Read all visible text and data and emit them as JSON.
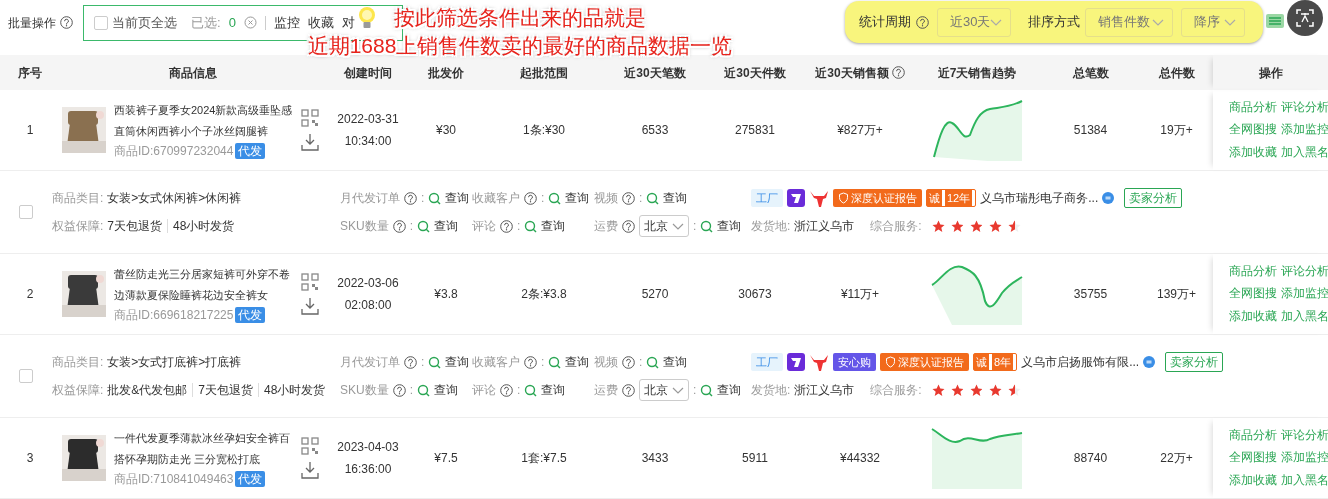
{
  "toolbar": {
    "batch_label": "批量操作",
    "select_all": {
      "label": "当前页全选",
      "checked": false
    },
    "selected_label": "已选:",
    "selected_count": "0",
    "actions": [
      "监控",
      "收藏",
      "对"
    ]
  },
  "filters": {
    "period_label": "统计周期",
    "period_value": "近30天",
    "sort_label": "排序方式",
    "sort_field": "销售件数",
    "sort_order": "降序"
  },
  "annotation": {
    "lines": [
      "按此筛选条件出来的品就是",
      "近期1688上销售件数卖的最好的商品数据一览"
    ]
  },
  "table": {
    "columns": [
      {
        "label": "序号"
      },
      {
        "label": "商品信息"
      },
      {
        "label": "创建时间"
      },
      {
        "label": "批发价"
      },
      {
        "label": "起批范围"
      },
      {
        "label": "近30天笔数"
      },
      {
        "label": "近30天件数"
      },
      {
        "label": "近30天销售额",
        "help": true
      },
      {
        "label": "近7天销售趋势"
      },
      {
        "label": "总笔数"
      },
      {
        "label": "总件数"
      },
      {
        "label": "操作"
      }
    ],
    "rows": [
      {
        "index": "1",
        "title": "西装裤子夏季女2024新款高级垂坠感直筒休闲西裤小个子冰丝阔腿裤",
        "id_label": "商品ID:",
        "id": "670997232044",
        "tag": "代发",
        "created_date": "2022-03-31",
        "created_time": "10:34:00",
        "price": "¥30",
        "moq": "1条:¥30",
        "orders_30d": "6533",
        "units_30d": "275831",
        "sales_30d": "¥827万+",
        "total_orders": "51384",
        "total_units": "19万+",
        "actions": [
          "商品分析",
          "评论分析",
          "全网图搜",
          "添加监控",
          "添加收藏",
          "加入黑名"
        ],
        "detail": {
          "checked": false,
          "category_label": "商品类目:",
          "category": "女装>女式休闲裤>休闲裤",
          "guarantee_label": "权益保障:",
          "guarantees": [
            "7天包退货",
            "48小时发货"
          ],
          "queries": [
            {
              "label": "月代发订单",
              "sep": ":",
              "action": "查询"
            },
            {
              "label": "收藏客户",
              "sep": ":",
              "action": "查询"
            },
            {
              "label": "视频",
              "sep": ":",
              "action": "查询"
            },
            {
              "label": "SKU数量",
              "sep": ":",
              "action": "查询"
            },
            {
              "label": "评论",
              "sep": ":",
              "action": "查询"
            },
            {
              "label": "运费",
              "select": "北京",
              "sep": ":",
              "action": "查询"
            }
          ],
          "badges": [
            {
              "kind": "factory",
              "text": "工厂"
            },
            {
              "kind": "purple-logo"
            },
            {
              "kind": "bull-logo"
            },
            {
              "kind": "cert",
              "text": "深度认证报告"
            },
            {
              "kind": "years",
              "mark": "诚",
              "text": "12年"
            }
          ],
          "shop": "义乌市瑞彤电子商务...",
          "seller_button": "卖家分析",
          "ship_label": "发货地:",
          "ship_from": "浙江义乌市",
          "service_label": "综合服务:",
          "stars": 4.5
        }
      },
      {
        "index": "2",
        "title": "蕾丝防走光三分居家短裤可外穿不卷边薄款夏保险睡裤花边安全裤女",
        "id_label": "商品ID:",
        "id": "669618217225",
        "tag": "代发",
        "created_date": "2022-03-06",
        "created_time": "02:08:00",
        "price": "¥3.8",
        "moq": "2条:¥3.8",
        "orders_30d": "5270",
        "units_30d": "30673",
        "sales_30d": "¥11万+",
        "total_orders": "35755",
        "total_units": "139万+",
        "actions": [
          "商品分析",
          "评论分析",
          "全网图搜",
          "添加监控",
          "添加收藏",
          "加入黑名"
        ],
        "detail": {
          "checked": false,
          "category_label": "商品类目:",
          "category": "女装>女式打底裤>打底裤",
          "guarantee_label": "权益保障:",
          "guarantees": [
            "批发&代发包邮",
            "7天包退货",
            "48小时发货"
          ],
          "queries": [
            {
              "label": "月代发订单",
              "sep": ":",
              "action": "查询"
            },
            {
              "label": "收藏客户",
              "sep": ":",
              "action": "查询"
            },
            {
              "label": "视频",
              "sep": ":",
              "action": "查询"
            },
            {
              "label": "SKU数量",
              "sep": ":",
              "action": "查询"
            },
            {
              "label": "评论",
              "sep": ":",
              "action": "查询"
            },
            {
              "label": "运费",
              "select": "北京",
              "sep": ":",
              "action": "查询"
            }
          ],
          "badges": [
            {
              "kind": "factory",
              "text": "工厂"
            },
            {
              "kind": "purple-logo"
            },
            {
              "kind": "bull-logo"
            },
            {
              "kind": "anxin",
              "text": "安心购"
            },
            {
              "kind": "cert",
              "text": "深度认证报告"
            },
            {
              "kind": "years",
              "mark": "诚",
              "text": "8年"
            }
          ],
          "shop": "义乌市启扬服饰有限...",
          "seller_button": "卖家分析",
          "ship_label": "发货地:",
          "ship_from": "浙江义乌市",
          "service_label": "综合服务:",
          "stars": 4.5
        }
      },
      {
        "index": "3",
        "title": "一件代发夏季薄款冰丝孕妇安全裤百搭怀孕期防走光 三分宽松打底",
        "id_label": "商品ID:",
        "id": "710841049463",
        "tag": "代发",
        "created_date": "2023-04-03",
        "created_time": "16:36:00",
        "price": "¥7.5",
        "moq": "1套:¥7.5",
        "orders_30d": "3433",
        "units_30d": "5911",
        "sales_30d": "¥44332",
        "total_orders": "88740",
        "total_units": "22万+",
        "actions": [
          "商品分析",
          "评论分析",
          "全网图搜",
          "添加监控",
          "添加收藏",
          "加入黑名"
        ]
      }
    ]
  }
}
